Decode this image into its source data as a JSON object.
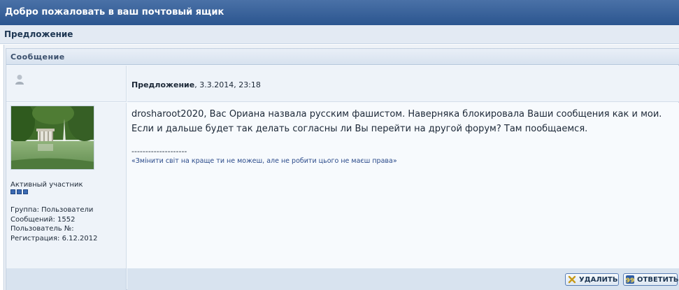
{
  "header": {
    "title": "Добро пожаловать в ваш почтовый ящик"
  },
  "subheader": {
    "title": "Предложение"
  },
  "panel": {
    "title": "Сообщение"
  },
  "post": {
    "subject": "Предложение",
    "date": ", 3.3.2014, 23:18",
    "body": "drosharoot2020, Вас Ориана назвала русским фашистом. Наверняка блокировала Ваши сообщения как и мои. Если и дальше будет так делать согласны ли Вы перейти на другой форум? Там пообщаемся.",
    "separator": "--------------------",
    "signature": "«Змінити світ на краще ти не можеш, але не робити цього не маєш права»"
  },
  "author": {
    "rank": "Активный участник",
    "rank_pips": 3,
    "group": "Группа: Пользователи",
    "posts": "Сообщений: 1552",
    "user_no": "Пользователь №:",
    "registered": "Регистрация: 6.12.2012"
  },
  "actions": {
    "delete_label": "УДАЛИТЬ",
    "reply_label": "ОТВЕТИТЬ"
  },
  "colors": {
    "header_bg": "#2b558f",
    "accent": "#3d6bb3",
    "signature": "#2a4a8a"
  }
}
